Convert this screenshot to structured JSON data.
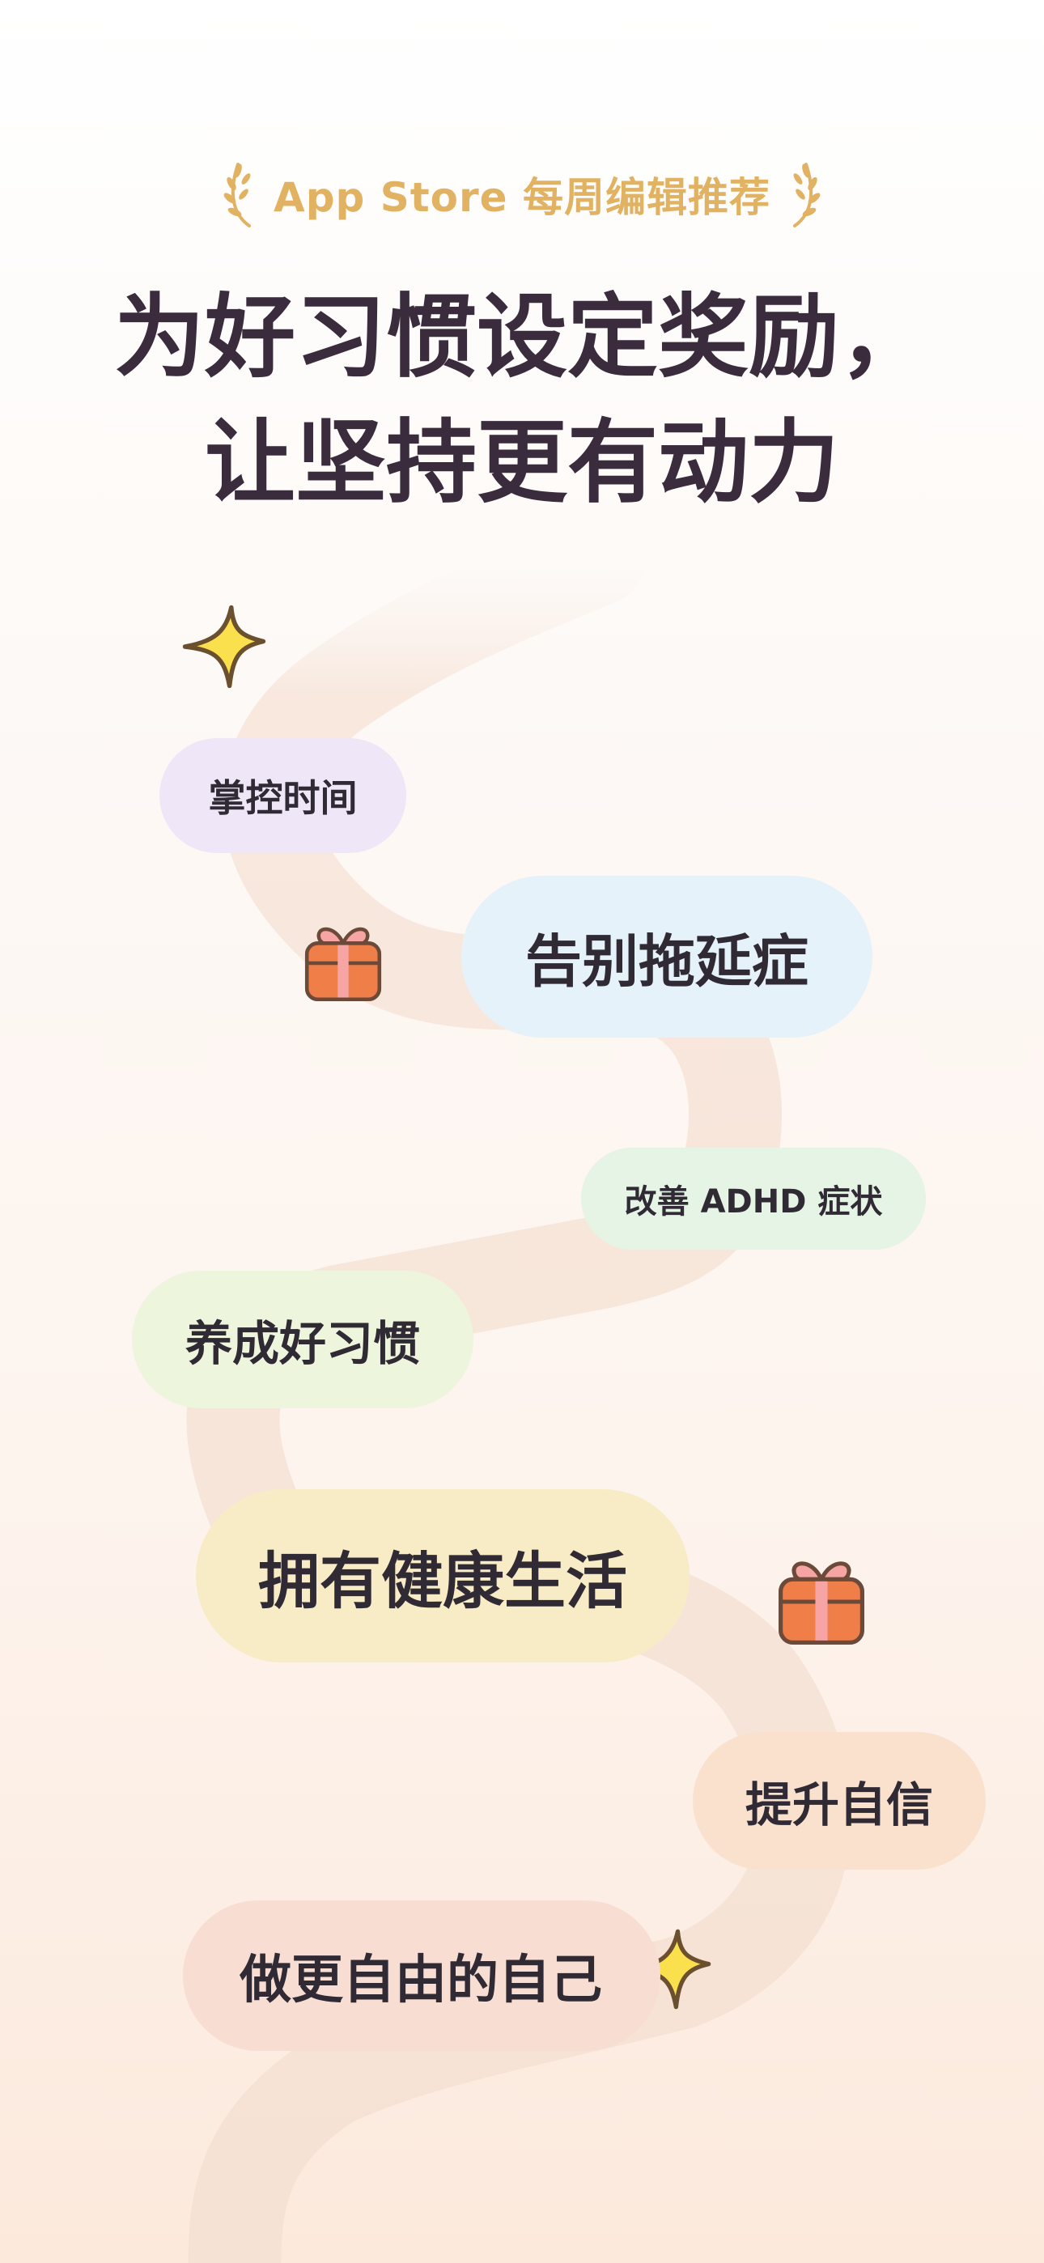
{
  "badge": {
    "text": "App Store 每周编辑推荐"
  },
  "headline": {
    "line1": "为好习惯设定奖励，",
    "line2": "让坚持更有动力"
  },
  "milestones": [
    {
      "label": "掌控时间"
    },
    {
      "label": "告别拖延症"
    },
    {
      "label": "改善 ADHD 症状"
    },
    {
      "label": "养成好习惯"
    },
    {
      "label": "拥有健康生活"
    },
    {
      "label": "提升自信"
    },
    {
      "label": "做更自由的自己"
    }
  ],
  "icons": [
    "laurel-left-icon",
    "laurel-right-icon",
    "sparkle-star-icon",
    "gift-box-icon"
  ],
  "colors": {
    "accent_gold": "#e0b262",
    "headline": "#3a2b3d",
    "road": "#f8e6da",
    "star": "#fbe04d",
    "gift": "#f07e49",
    "ribbon": "#f6a4a4"
  }
}
